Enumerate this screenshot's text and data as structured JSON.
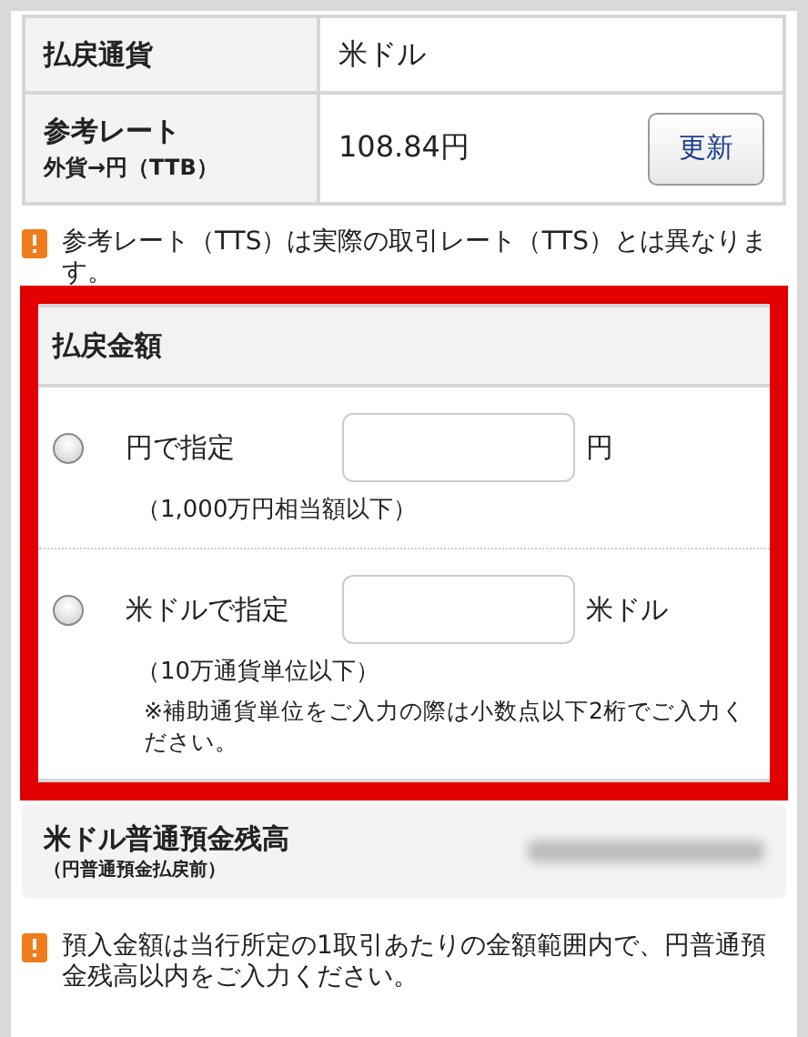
{
  "info_table": [
    {
      "label": "払戻通貨",
      "value": "米ドル"
    },
    {
      "label": "参考レート",
      "sublabel": "外貨→円（TTB）",
      "value": "108.84円",
      "button": "更新"
    }
  ],
  "notice_top": "参考レート（TTS）は実際の取引レート（TTS）とは異なります。",
  "amount_section": {
    "title": "払戻金額",
    "options": [
      {
        "label": "円で指定",
        "unit": "円",
        "note": "（1,000万円相当額以下）",
        "selected": false
      },
      {
        "label": "米ドルで指定",
        "unit": "米ドル",
        "note": "（10万通貨単位以下）",
        "sub_note": "※補助通貨単位をご入力の際は小数点以下2桁でご入力ください。",
        "selected": false
      }
    ]
  },
  "balance": {
    "label": "米ドル普通預金残高",
    "sublabel": "（円普通預金払戻前）",
    "value_hidden": true
  },
  "notice_bottom": "預入金額は当行所定の1取引あたりの金額範囲内で、円普通預金残高以内をご入力ください。"
}
